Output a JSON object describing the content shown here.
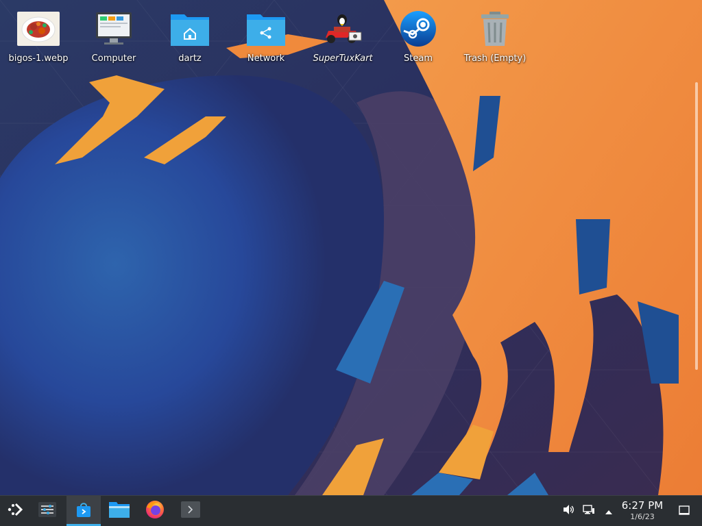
{
  "desktop": {
    "icons": [
      {
        "label": "bigos-1.webp",
        "icon": "image-thumbnail-icon"
      },
      {
        "label": "Computer",
        "icon": "computer-icon"
      },
      {
        "label": "dartz",
        "icon": "home-folder-icon"
      },
      {
        "label": "Network",
        "icon": "network-folder-icon"
      },
      {
        "label": "SuperTuxKart",
        "icon": "supertuxkart-icon"
      },
      {
        "label": "Steam",
        "icon": "steam-icon"
      },
      {
        "label": "Trash (Empty)",
        "icon": "trash-icon"
      }
    ]
  },
  "taskbar": {
    "launchers": [
      {
        "name": "application-launcher",
        "icon": "app-launcher-icon"
      },
      {
        "name": "steamos-settings",
        "icon": "sliders-icon"
      },
      {
        "name": "discover-store",
        "icon": "store-bag-icon",
        "active": true
      },
      {
        "name": "dolphin-file-manager",
        "icon": "folder-icon"
      },
      {
        "name": "firefox",
        "icon": "firefox-icon"
      },
      {
        "name": "konsole",
        "icon": "terminal-icon"
      }
    ],
    "tray": {
      "volume_icon": "speaker-icon",
      "network_icon": "wired-network-icon",
      "expand_icon": "arrow-up-icon",
      "show_desktop_icon": "show-desktop-icon"
    },
    "clock": {
      "time": "6:27 PM",
      "date": "1/6/23"
    }
  },
  "colors": {
    "accent": "#3daee9",
    "panel": "#2a2e32",
    "wallpaper_orange": "#f08a3c",
    "wallpaper_blue": "#2a6fb5",
    "wallpaper_navy": "#1e2a5a"
  }
}
